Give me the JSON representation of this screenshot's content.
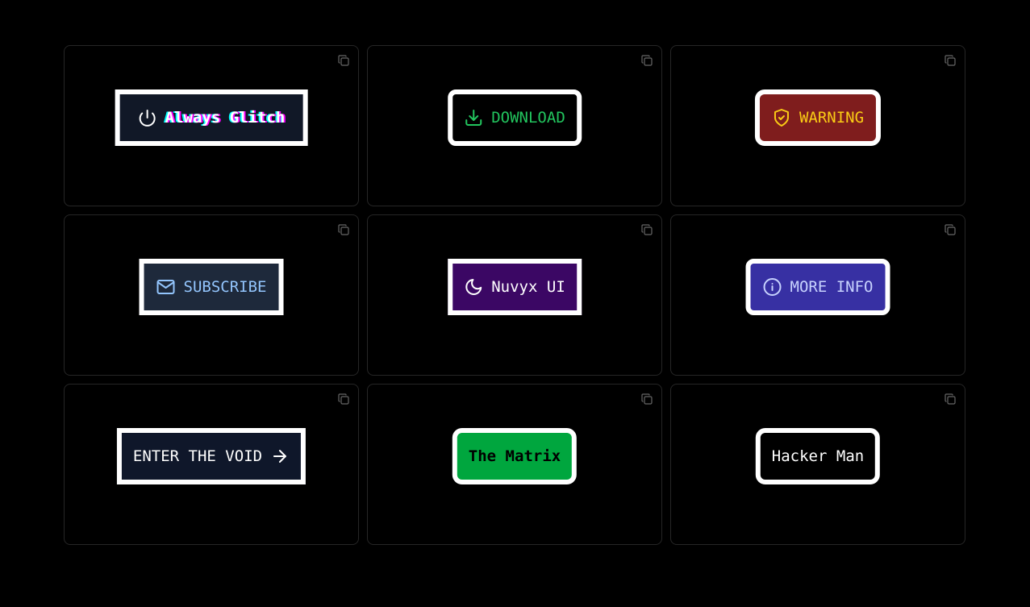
{
  "cards": [
    {
      "label": "Always Glitch",
      "icon": "power-icon"
    },
    {
      "label": "DOWNLOAD",
      "icon": "download-icon"
    },
    {
      "label": "WARNING",
      "icon": "shield-check-icon"
    },
    {
      "label": "SUBSCRIBE",
      "icon": "mail-icon"
    },
    {
      "label": "Nuvyx UI",
      "icon": "moon-icon"
    },
    {
      "label": "MORE INFO",
      "icon": "info-icon"
    },
    {
      "label": "ENTER THE VOID",
      "icon": "arrow-right-icon"
    },
    {
      "label": "The Matrix",
      "icon": ""
    },
    {
      "label": "Hacker Man",
      "icon": ""
    }
  ],
  "copy_icon": "copy-icon",
  "colors": {
    "background": "#000000",
    "card_border": "#262626",
    "button_border": "#ffffff",
    "glitch_bg": "#111827",
    "download_text": "#22c55e",
    "warning_bg": "#7f1d1d",
    "warning_text": "#facc15",
    "subscribe_bg": "#1e293b",
    "subscribe_text": "#93c5fd",
    "nuvyx_bg": "#3b0764",
    "info_bg": "#3730a3",
    "info_text": "#c7d2fe",
    "void_bg": "#0f172a",
    "matrix_bg": "#00a63e"
  }
}
